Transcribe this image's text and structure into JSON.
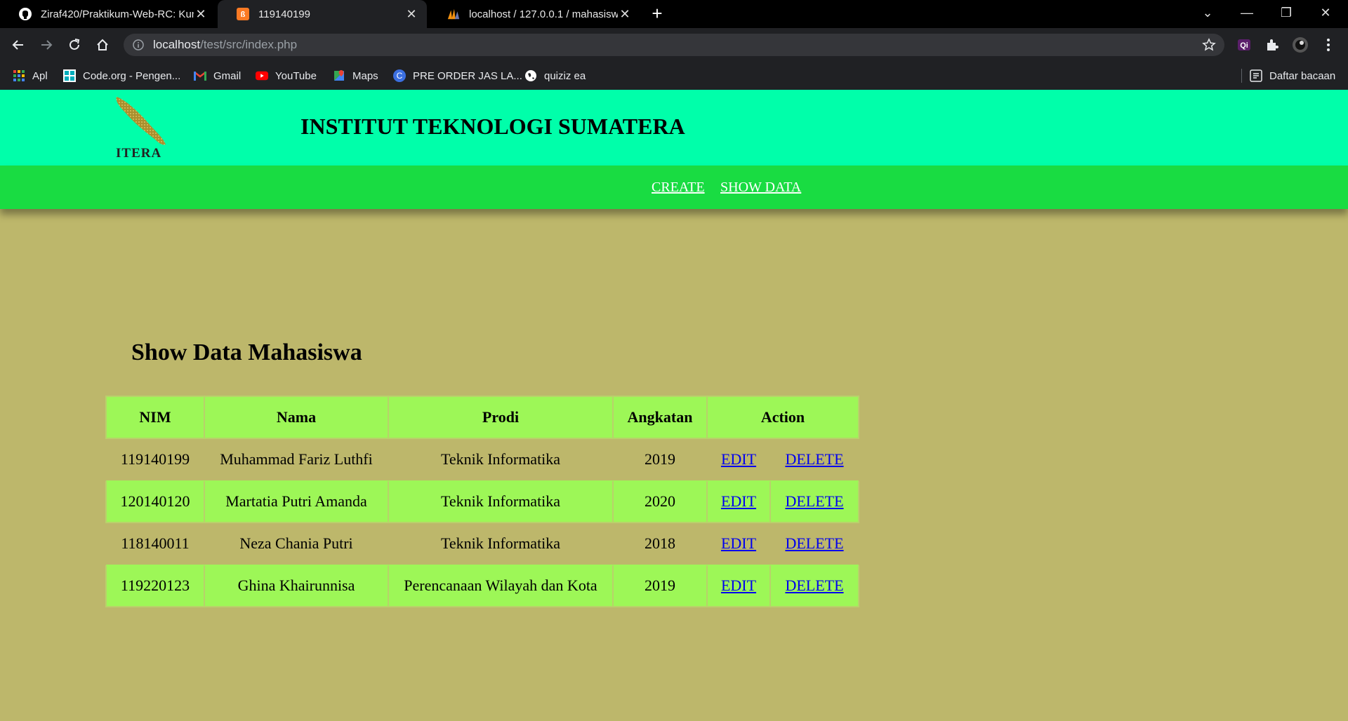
{
  "browser": {
    "tabs": [
      {
        "title": "Ziraf420/Praktikum-Web-RC: Kum",
        "active": false
      },
      {
        "title": "119140199",
        "active": true
      },
      {
        "title": "localhost / 127.0.0.1 / mahasiswa",
        "active": false
      }
    ],
    "url_host": "localhost",
    "url_path": "/test/src/index.php",
    "bookmarks": [
      {
        "label": "Apl",
        "icon": "apps-grid-icon"
      },
      {
        "label": "Code.org - Pengen...",
        "icon": "code-org-icon"
      },
      {
        "label": "Gmail",
        "icon": "gmail-icon"
      },
      {
        "label": "YouTube",
        "icon": "youtube-icon"
      },
      {
        "label": "Maps",
        "icon": "maps-icon"
      },
      {
        "label": "PRE ORDER JAS LA...",
        "icon": "c-circle-icon"
      },
      {
        "label": "quiziz ea",
        "icon": "globe-icon"
      }
    ],
    "reading_list": "Daftar bacaan"
  },
  "site": {
    "logo_text": "ITERA",
    "title": "INSTITUT TEKNOLOGI SUMATERA",
    "nav": {
      "create": "CREATE",
      "show": "SHOW DATA"
    }
  },
  "main": {
    "heading": "Show Data Mahasiswa",
    "columns": {
      "nim": "NIM",
      "nama": "Nama",
      "prodi": "Prodi",
      "angkatan": "Angkatan",
      "action": "Action"
    },
    "edit_label": "EDIT",
    "delete_label": "DELETE",
    "rows": [
      {
        "nim": "119140199",
        "nama": "Muhammad Fariz Luthfi",
        "prodi": "Teknik Informatika",
        "angkatan": "2019"
      },
      {
        "nim": "120140120",
        "nama": "Martatia Putri Amanda",
        "prodi": "Teknik Informatika",
        "angkatan": "2020"
      },
      {
        "nim": "118140011",
        "nama": "Neza Chania Putri",
        "prodi": "Teknik Informatika",
        "angkatan": "2018"
      },
      {
        "nim": "119220123",
        "nama": "Ghina Khairunnisa",
        "prodi": "Perencanaan Wilayah dan Kota",
        "angkatan": "2019"
      }
    ]
  },
  "colors": {
    "header": "#00ffaa",
    "nav": "#19dc42",
    "page_bg": "#bdb76b",
    "row_green": "#9df757"
  }
}
